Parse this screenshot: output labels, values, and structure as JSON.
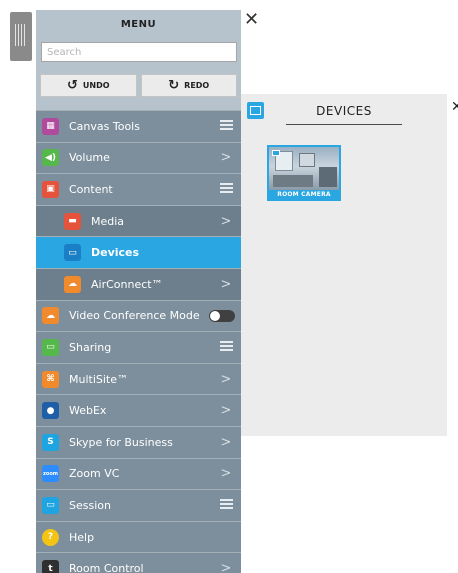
{
  "menu": {
    "title": "MENU",
    "search_placeholder": "Search",
    "undo_label": "UNDO",
    "redo_label": "REDO",
    "items": [
      {
        "label": "Canvas Tools",
        "icon": "canvas-tools-icon",
        "color": "#b04a9c",
        "trail": "list"
      },
      {
        "label": "Volume",
        "icon": "volume-icon",
        "color": "#55b84a",
        "trail": "chevron"
      },
      {
        "label": "Content",
        "icon": "content-icon",
        "color": "#e5533d",
        "trail": "list"
      },
      {
        "label": "Media",
        "icon": "media-icon",
        "color": "#e5533d",
        "trail": "chevron",
        "sub": true
      },
      {
        "label": "Devices",
        "icon": "devices-icon",
        "color": "#1a7fc4",
        "trail": "none",
        "sub": true,
        "active": true
      },
      {
        "label": "AirConnect™",
        "icon": "airconnect-icon",
        "color": "#f08a2c",
        "trail": "chevron",
        "sub": true
      },
      {
        "label": "Video Conference Mode",
        "icon": "video-conference-icon",
        "color": "#f08a2c",
        "trail": "toggle"
      },
      {
        "label": "Sharing",
        "icon": "sharing-icon",
        "color": "#55b84a",
        "trail": "list"
      },
      {
        "label": "MultiSite™",
        "icon": "multisite-icon",
        "color": "#f08a2c",
        "trail": "chevron"
      },
      {
        "label": "WebEx",
        "icon": "webex-icon",
        "color": "#1f5fa8",
        "trail": "chevron"
      },
      {
        "label": "Skype for Business",
        "icon": "skype-icon",
        "color": "#1ea4e0",
        "trail": "chevron"
      },
      {
        "label": "Zoom VC",
        "icon": "zoom-icon",
        "color": "#2d8cff",
        "trail": "chevron"
      },
      {
        "label": "Session",
        "icon": "session-icon",
        "color": "#1ea4e0",
        "trail": "list"
      },
      {
        "label": "Help",
        "icon": "help-icon",
        "color": "#f4c414",
        "trail": "none"
      },
      {
        "label": "Room Control",
        "icon": "room-control-icon",
        "color": "#2f2f2f",
        "trail": "chevron"
      }
    ]
  },
  "devices_panel": {
    "title": "DEVICES",
    "tiles": [
      {
        "label": "ROOM CAMERA"
      }
    ]
  },
  "glyphs": {
    "undo": "↺",
    "redo": "↻",
    "chevron": ">",
    "close": "✕",
    "icon_canvas": "▦",
    "icon_volume": "◀)",
    "icon_content": "▣",
    "icon_media": "▬",
    "icon_devices": "▭",
    "icon_airconnect": "☁",
    "icon_video": "☁",
    "icon_sharing": "▭",
    "icon_multisite": "⌘",
    "icon_webex": "●",
    "icon_skype": "S",
    "icon_zoom": "zoom",
    "icon_session": "▭",
    "icon_help": "?",
    "icon_room": "t"
  }
}
